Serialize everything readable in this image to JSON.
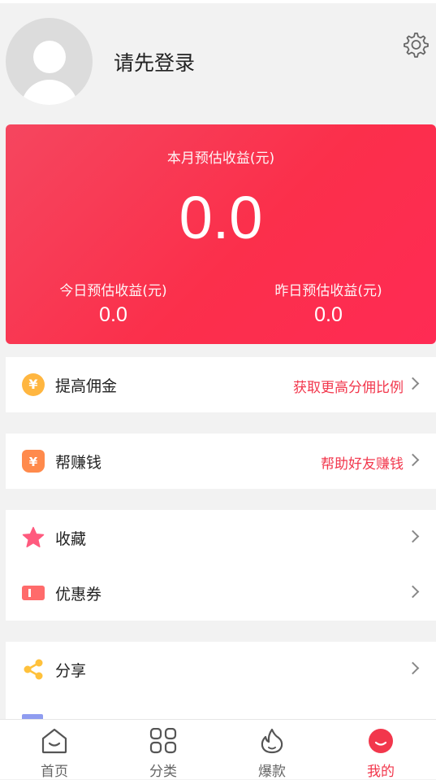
{
  "header": {
    "login_prompt": "请先登录",
    "settings_icon": "gear-icon",
    "avatar_icon": "default-avatar-icon"
  },
  "earnings": {
    "month_label": "本月预估收益(元)",
    "month_value": "0.0",
    "today_label": "今日预估收益(元)",
    "today_value": "0.0",
    "yesterday_label": "昨日预估收益(元)",
    "yesterday_value": "0.0",
    "gradient_colors": [
      "#f5465f",
      "#ff2b54"
    ]
  },
  "menu": {
    "boost_commission": {
      "label": "提高佣金",
      "hint": "获取更高分佣比例",
      "icon": "yen-coin-icon"
    },
    "help_earn": {
      "label": "帮赚钱",
      "hint": "帮助好友赚钱",
      "icon": "money-bag-icon"
    },
    "favorites": {
      "label": "收藏",
      "icon": "star-icon"
    },
    "coupons": {
      "label": "优惠券",
      "icon": "coupon-icon"
    },
    "share": {
      "label": "分享",
      "icon": "share-icon"
    }
  },
  "tabs": [
    {
      "label": "首页",
      "icon": "home-icon",
      "active": false
    },
    {
      "label": "分类",
      "icon": "grid-icon",
      "active": false
    },
    {
      "label": "爆款",
      "icon": "flame-icon",
      "active": false
    },
    {
      "label": "我的",
      "icon": "profile-smile-icon",
      "active": true
    }
  ],
  "colors": {
    "accent": "#f2374c",
    "background": "#f2f2f2",
    "coin": "#ffb640",
    "bag": "#ff8a4c",
    "star": "#ff5a7e",
    "coupon": "#ff6b6b",
    "share": "#ffc13b"
  }
}
